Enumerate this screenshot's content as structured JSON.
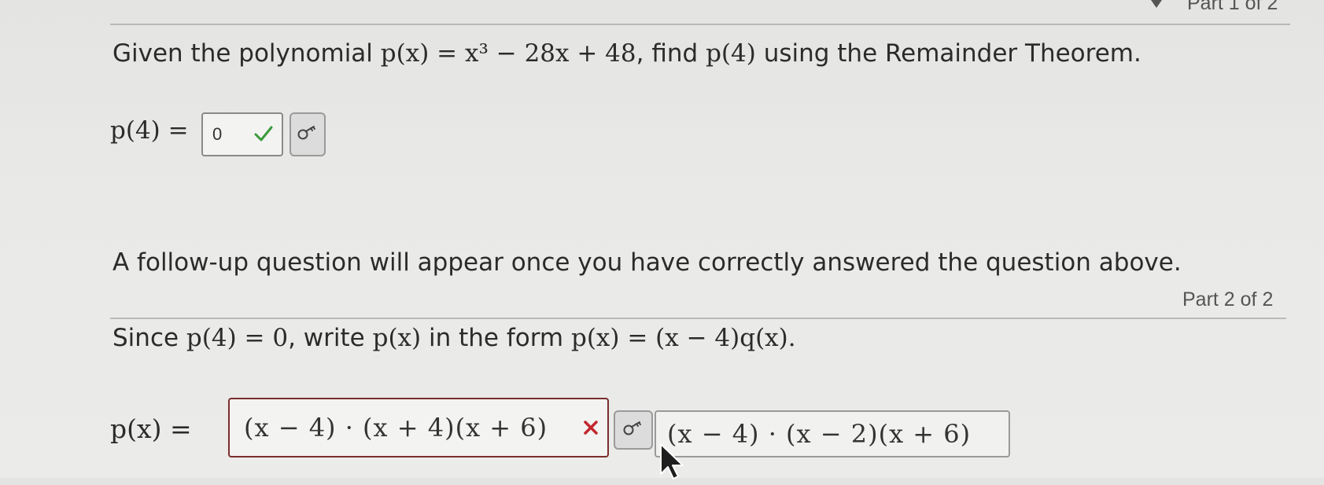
{
  "part1": {
    "part_label": "Part 1 of 2",
    "question_prefix": "Given the polynomial",
    "polynomial": "p(x) = x³ − 28x + 48",
    "question_mid": ", find",
    "target": "p(4)",
    "question_suffix": "using the Remainder Theorem.",
    "answer_label": "p(4) =",
    "answer_value": "0",
    "answer_status": "correct",
    "followup_text": "A follow-up question will appear once you have correctly answered the question above."
  },
  "part2": {
    "part_label": "Part 2 of 2",
    "question_prefix": "Since",
    "given": "p(4) = 0",
    "question_mid": ", write",
    "target": "p(x)",
    "question_mid2": "in the form",
    "form": "p(x) = (x − 4)q(x).",
    "answer_label": "p(x) =",
    "answer_value": "(x − 4) · (x + 4)(x + 6)",
    "answer_status": "incorrect",
    "correct_answer": "(x − 4) · (x − 2)(x + 6)"
  },
  "colors": {
    "correct": "#3a9a3a",
    "incorrect": "#c0282d",
    "rule": "#b9b9b9"
  },
  "icons": {
    "check": "check-icon",
    "wrong": "x-icon",
    "key": "key-icon"
  }
}
